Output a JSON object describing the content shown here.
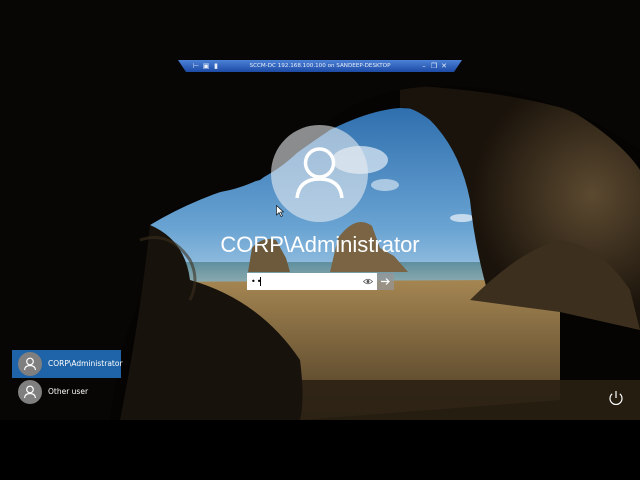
{
  "remote_session": {
    "title": "SCCM-DC 192.168.100.100 on SANDEEP-DESKTOP",
    "left_icons": [
      "pin-icon",
      "lock-icon",
      "signal-icon"
    ],
    "right_icons": [
      "minimize-icon",
      "restore-icon",
      "close-icon"
    ]
  },
  "login": {
    "user_name": "CORP\\Administrator",
    "password_mask": "••",
    "reveal_icon": "eye-icon",
    "submit_icon": "arrow-right-icon"
  },
  "user_list": [
    {
      "label": "CORP\\Administrator",
      "selected": true
    },
    {
      "label": "Other user",
      "selected": false
    }
  ],
  "system": {
    "power_icon": "power-icon"
  },
  "colors": {
    "selected_tile": "#1f64a8",
    "avatar_circle": "#ebeef2",
    "tile_avatar": "#7f7f7f"
  }
}
